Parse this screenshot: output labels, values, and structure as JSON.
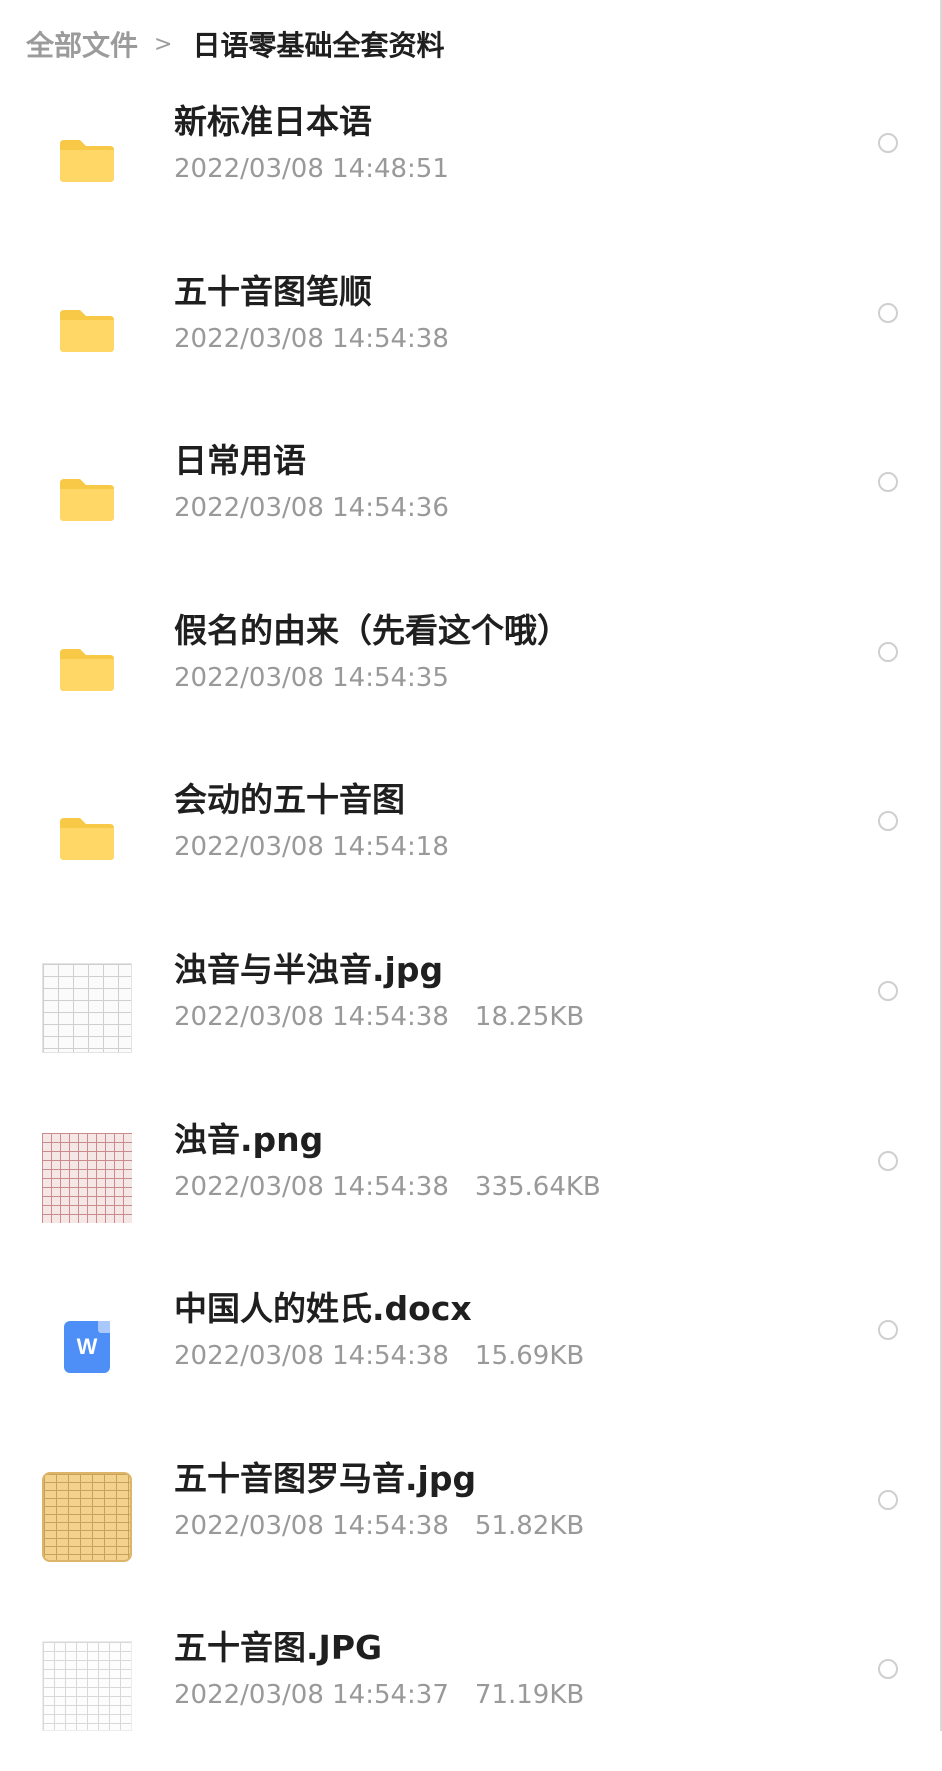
{
  "breadcrumb": {
    "root": "全部文件",
    "separator": ">",
    "current": "日语零基础全套资料"
  },
  "colors": {
    "folder": "#ffd766",
    "folder_tab": "#f7c947",
    "word_icon": "#4d8ef7",
    "meta_text": "#999999",
    "title_text": "#1f1f1f"
  },
  "files": [
    {
      "name": "新标准日本语",
      "date": "2022/03/08 14:48:51",
      "size": "",
      "type": "folder",
      "icon": "folder-icon"
    },
    {
      "name": "五十音图笔顺",
      "date": "2022/03/08 14:54:38",
      "size": "",
      "type": "folder",
      "icon": "folder-icon"
    },
    {
      "name": "日常用语",
      "date": "2022/03/08 14:54:36",
      "size": "",
      "type": "folder",
      "icon": "folder-icon"
    },
    {
      "name": "假名的由来（先看这个哦）",
      "date": "2022/03/08 14:54:35",
      "size": "",
      "type": "folder",
      "icon": "folder-icon"
    },
    {
      "name": "会动的五十音图",
      "date": "2022/03/08 14:54:18",
      "size": "",
      "type": "folder",
      "icon": "folder-icon"
    },
    {
      "name": "浊音与半浊音.jpg",
      "date": "2022/03/08 14:54:38",
      "size": "18.25KB",
      "type": "image",
      "icon": "image-thumbnail"
    },
    {
      "name": "浊音.png",
      "date": "2022/03/08 14:54:38",
      "size": "335.64KB",
      "type": "image",
      "icon": "image-thumbnail"
    },
    {
      "name": "中国人的姓氏.docx",
      "date": "2022/03/08 14:54:38",
      "size": "15.69KB",
      "type": "docx",
      "icon": "word-doc-icon",
      "icon_letter": "W"
    },
    {
      "name": "五十音图罗马音.jpg",
      "date": "2022/03/08 14:54:38",
      "size": "51.82KB",
      "type": "image",
      "icon": "image-thumbnail"
    },
    {
      "name": "五十音图.JPG",
      "date": "2022/03/08 14:54:37",
      "size": "71.19KB",
      "type": "image",
      "icon": "image-thumbnail"
    }
  ]
}
